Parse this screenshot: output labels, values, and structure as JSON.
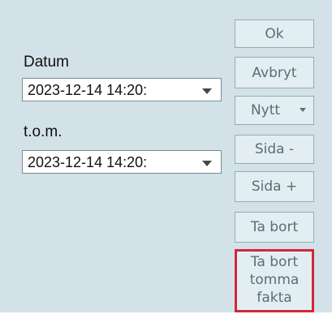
{
  "date_from": {
    "label": "Datum",
    "value": "2023-12-14 14:20:"
  },
  "date_to": {
    "label": "t.o.m.",
    "value": "2023-12-14 14:20:"
  },
  "buttons": {
    "ok": "Ok",
    "cancel": "Avbryt",
    "new": "Nytt",
    "page_minus": "Sida -",
    "page_plus": "Sida +",
    "delete": "Ta bort",
    "delete_empty": [
      "Ta bort",
      "tomma",
      "fakta"
    ]
  },
  "icons": {
    "dropdown": "chevron-down-icon"
  },
  "colors": {
    "panel_bg": "#d3e2e8",
    "button_text": "#5b6e76",
    "highlight_border": "#d3263a"
  }
}
